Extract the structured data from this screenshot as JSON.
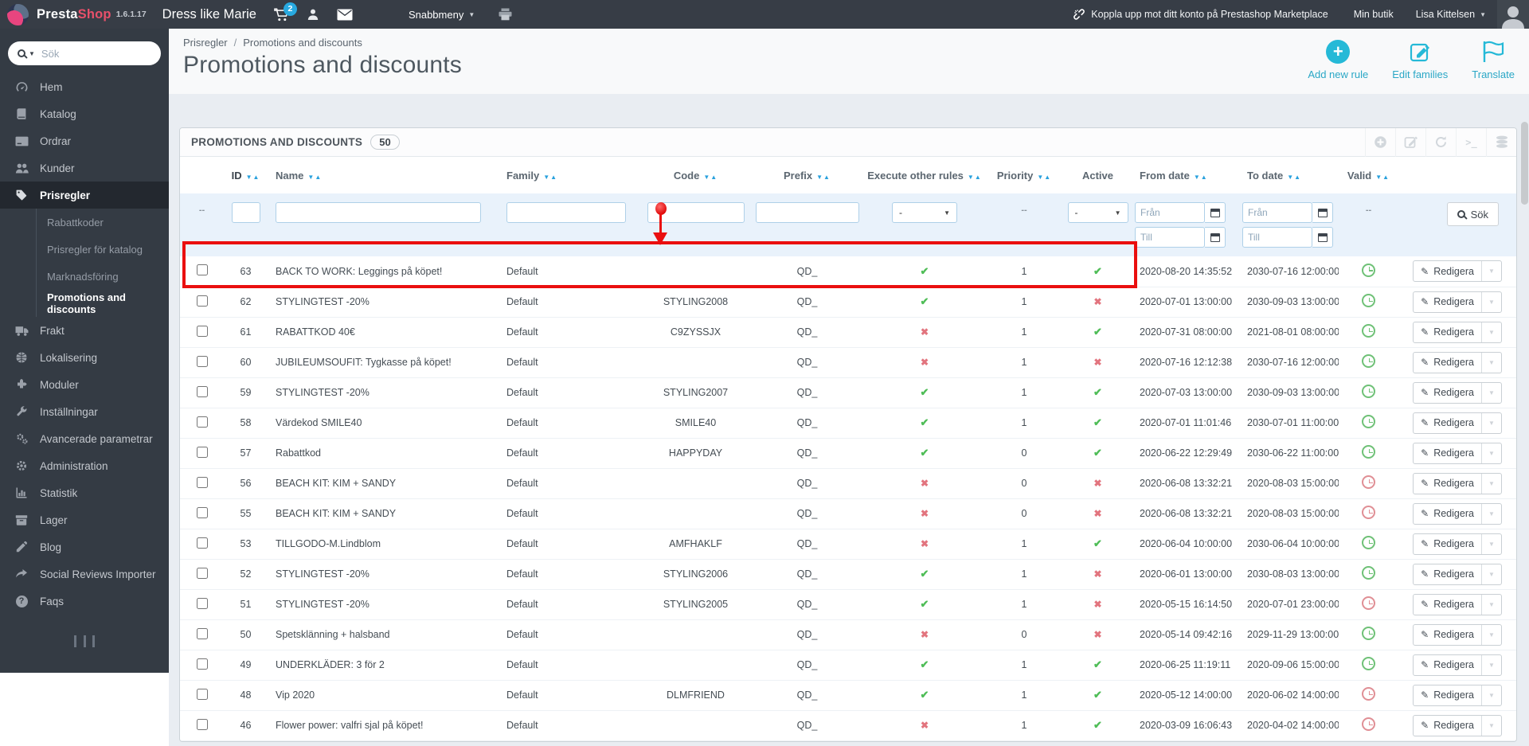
{
  "topbar": {
    "brand_presta": "Presta",
    "brand_shop": "Shop",
    "version": "1.6.1.17",
    "shop_name": "Dress like Marie",
    "cart_badge": "2",
    "quick_menu_label": "Snabbmeny",
    "marketplace_link": "Koppla upp mot ditt konto på Prestashop Marketplace",
    "my_shop_label": "Min butik",
    "user_name": "Lisa Kittelsen",
    "icons": [
      "cart-icon",
      "user-icon",
      "mail-icon",
      "print-icon",
      "chain-broken-icon",
      "avatar"
    ]
  },
  "sidebar": {
    "search_placeholder": "Sök",
    "items": [
      {
        "label": "Hem",
        "icon": "dashboard-icon"
      },
      {
        "label": "Katalog",
        "icon": "book-icon"
      },
      {
        "label": "Ordrar",
        "icon": "credit-card-icon"
      },
      {
        "label": "Kunder",
        "icon": "users-icon"
      },
      {
        "label": "Prisregler",
        "icon": "tag-icon",
        "active": true
      },
      {
        "label": "Frakt",
        "icon": "truck-icon"
      },
      {
        "label": "Lokalisering",
        "icon": "globe-icon"
      },
      {
        "label": "Moduler",
        "icon": "puzzle-icon"
      },
      {
        "label": "Inställningar",
        "icon": "wrench-icon"
      },
      {
        "label": "Avancerade parametrar",
        "icon": "cogs-icon"
      },
      {
        "label": "Administration",
        "icon": "gear-icon"
      },
      {
        "label": "Statistik",
        "icon": "bar-chart-icon"
      },
      {
        "label": "Lager",
        "icon": "archive-icon"
      },
      {
        "label": "Blog",
        "icon": "pencil-icon"
      },
      {
        "label": "Social Reviews Importer",
        "icon": "share-icon"
      },
      {
        "label": "Faqs",
        "icon": "question-icon"
      }
    ],
    "submenu": [
      {
        "label": "Rabattkoder"
      },
      {
        "label": "Prisregler för katalog"
      },
      {
        "label": "Marknadsföring"
      },
      {
        "label": "Promotions and discounts",
        "active": true
      }
    ]
  },
  "page": {
    "breadcrumb": [
      "Prisregler",
      "Promotions and discounts"
    ],
    "breadcrumb_separator": "/",
    "title": "Promotions and discounts",
    "actions": [
      {
        "label": "Add new rule",
        "icon": "plus-circle-icon"
      },
      {
        "label": "Edit families",
        "icon": "edit-icon"
      },
      {
        "label": "Translate",
        "icon": "flag-icon"
      }
    ]
  },
  "panel": {
    "title": "PROMOTIONS AND DISCOUNTS",
    "count": "50",
    "toolbar_icons": [
      "add-icon",
      "edit-icon",
      "refresh-icon",
      "terminal-icon",
      "database-icon"
    ]
  },
  "table": {
    "columns": [
      "ID",
      "Name",
      "Family",
      "Code",
      "Prefix",
      "Execute other rules",
      "Priority",
      "Active",
      "From date",
      "To date",
      "Valid"
    ],
    "filters": {
      "empty": "--",
      "select_value": "-",
      "from_placeholder": "Från",
      "till_placeholder": "Till",
      "search_label": "Sök"
    },
    "edit_label": "Redigera",
    "rows": [
      {
        "id": "63",
        "name": "BACK TO WORK: Leggings på köpet!",
        "family": "Default",
        "code": "",
        "prefix": "QD_",
        "execute": true,
        "priority": "1",
        "active": true,
        "from": "2020-08-20 14:35:52",
        "to": "2030-07-16 12:00:00",
        "valid": true
      },
      {
        "id": "62",
        "name": "STYLINGTEST -20%",
        "family": "Default",
        "code": "STYLING2008",
        "prefix": "QD_",
        "execute": true,
        "priority": "1",
        "active": false,
        "from": "2020-07-01 13:00:00",
        "to": "2030-09-03 13:00:00",
        "valid": true
      },
      {
        "id": "61",
        "name": "RABATTKOD 40€",
        "family": "Default",
        "code": "C9ZYSSJX",
        "prefix": "QD_",
        "execute": false,
        "priority": "1",
        "active": true,
        "from": "2020-07-31 08:00:00",
        "to": "2021-08-01 08:00:00",
        "valid": true
      },
      {
        "id": "60",
        "name": "JUBILEUMSOUFIT: Tygkasse på köpet!",
        "family": "Default",
        "code": "",
        "prefix": "QD_",
        "execute": false,
        "priority": "1",
        "active": false,
        "from": "2020-07-16 12:12:38",
        "to": "2030-07-16 12:00:00",
        "valid": true
      },
      {
        "id": "59",
        "name": "STYLINGTEST -20%",
        "family": "Default",
        "code": "STYLING2007",
        "prefix": "QD_",
        "execute": true,
        "priority": "1",
        "active": true,
        "from": "2020-07-03 13:00:00",
        "to": "2030-09-03 13:00:00",
        "valid": true
      },
      {
        "id": "58",
        "name": "Värdekod SMILE40",
        "family": "Default",
        "code": "SMILE40",
        "prefix": "QD_",
        "execute": true,
        "priority": "1",
        "active": true,
        "from": "2020-07-01 11:01:46",
        "to": "2030-07-01 11:00:00",
        "valid": true
      },
      {
        "id": "57",
        "name": "Rabattkod",
        "family": "Default",
        "code": "HAPPYDAY",
        "prefix": "QD_",
        "execute": true,
        "priority": "0",
        "active": true,
        "from": "2020-06-22 12:29:49",
        "to": "2030-06-22 11:00:00",
        "valid": true
      },
      {
        "id": "56",
        "name": "BEACH KIT: KIM + SANDY",
        "family": "Default",
        "code": "",
        "prefix": "QD_",
        "execute": false,
        "priority": "0",
        "active": false,
        "from": "2020-06-08 13:32:21",
        "to": "2020-08-03 15:00:00",
        "valid": false
      },
      {
        "id": "55",
        "name": "BEACH KIT: KIM + SANDY",
        "family": "Default",
        "code": "",
        "prefix": "QD_",
        "execute": false,
        "priority": "0",
        "active": false,
        "from": "2020-06-08 13:32:21",
        "to": "2020-08-03 15:00:00",
        "valid": false
      },
      {
        "id": "53",
        "name": "TILLGODO-M.Lindblom",
        "family": "Default",
        "code": "AMFHAKLF",
        "prefix": "QD_",
        "execute": false,
        "priority": "1",
        "active": true,
        "from": "2020-06-04 10:00:00",
        "to": "2030-06-04 10:00:00",
        "valid": true
      },
      {
        "id": "52",
        "name": "STYLINGTEST -20%",
        "family": "Default",
        "code": "STYLING2006",
        "prefix": "QD_",
        "execute": true,
        "priority": "1",
        "active": false,
        "from": "2020-06-01 13:00:00",
        "to": "2030-08-03 13:00:00",
        "valid": true
      },
      {
        "id": "51",
        "name": "STYLINGTEST -20%",
        "family": "Default",
        "code": "STYLING2005",
        "prefix": "QD_",
        "execute": true,
        "priority": "1",
        "active": false,
        "from": "2020-05-15 16:14:50",
        "to": "2020-07-01 23:00:00",
        "valid": false
      },
      {
        "id": "50",
        "name": "Spetsklänning + halsband",
        "family": "Default",
        "code": "",
        "prefix": "QD_",
        "execute": false,
        "priority": "0",
        "active": false,
        "from": "2020-05-14 09:42:16",
        "to": "2029-11-29 13:00:00",
        "valid": true
      },
      {
        "id": "49",
        "name": "UNDERKLÄDER: 3 för 2",
        "family": "Default",
        "code": "",
        "prefix": "QD_",
        "execute": true,
        "priority": "1",
        "active": true,
        "from": "2020-06-25 11:19:11",
        "to": "2020-09-06 15:00:00",
        "valid": true
      },
      {
        "id": "48",
        "name": "Vip 2020",
        "family": "Default",
        "code": "DLMFRIEND",
        "prefix": "QD_",
        "execute": true,
        "priority": "1",
        "active": true,
        "from": "2020-05-12 14:00:00",
        "to": "2020-06-02 14:00:00",
        "valid": false
      },
      {
        "id": "46",
        "name": "Flower power: valfri sjal på köpet!",
        "family": "Default",
        "code": "",
        "prefix": "QD_",
        "execute": false,
        "priority": "1",
        "active": true,
        "from": "2020-03-09 16:06:43",
        "to": "2020-04-02 14:00:00",
        "valid": false
      }
    ]
  }
}
